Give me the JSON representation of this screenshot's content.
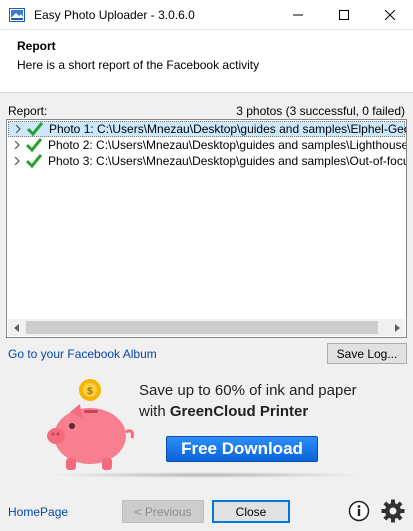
{
  "window": {
    "title": "Easy Photo Uploader - 3.0.6.0",
    "app_icon": "photo-uploader-icon",
    "controls": [
      "minimize-icon",
      "maximize-icon",
      "close-icon"
    ]
  },
  "header": {
    "title": "Report",
    "subtitle": "Here is a short report of the Facebook activity"
  },
  "report": {
    "label": "Report:",
    "summary": "3 photos (3 successful, 0 failed)",
    "items": [
      {
        "text": "Photo 1: C:\\Users\\Mnezau\\Desktop\\guides and samples\\Elphel-GeoTagged",
        "status": "success",
        "selected": true
      },
      {
        "text": "Photo 2: C:\\Users\\Mnezau\\Desktop\\guides and samples\\Lighthouse.jpg",
        "status": "success",
        "selected": false
      },
      {
        "text": "Photo 3: C:\\Users\\Mnezau\\Desktop\\guides and samples\\Out-of-focus-Pair",
        "status": "success",
        "selected": false
      }
    ]
  },
  "links": {
    "facebook_album": "Go to your Facebook Album",
    "homepage": "HomePage"
  },
  "buttons": {
    "save_log": "Save Log...",
    "previous": "< Previous",
    "close": "Close"
  },
  "ad": {
    "line1": "Save up to 60% of ink and paper",
    "line2_prefix": "with ",
    "line2_brand": "GreenCloud Printer",
    "download": "Free Download",
    "image": "piggy-bank-icon"
  },
  "colors": {
    "link": "#0645ad",
    "selection": "#cce8ff",
    "check": "#2aa12a",
    "download_button": "#1874e8",
    "piggy": "#f77f8f",
    "coin": "#f5b400"
  }
}
